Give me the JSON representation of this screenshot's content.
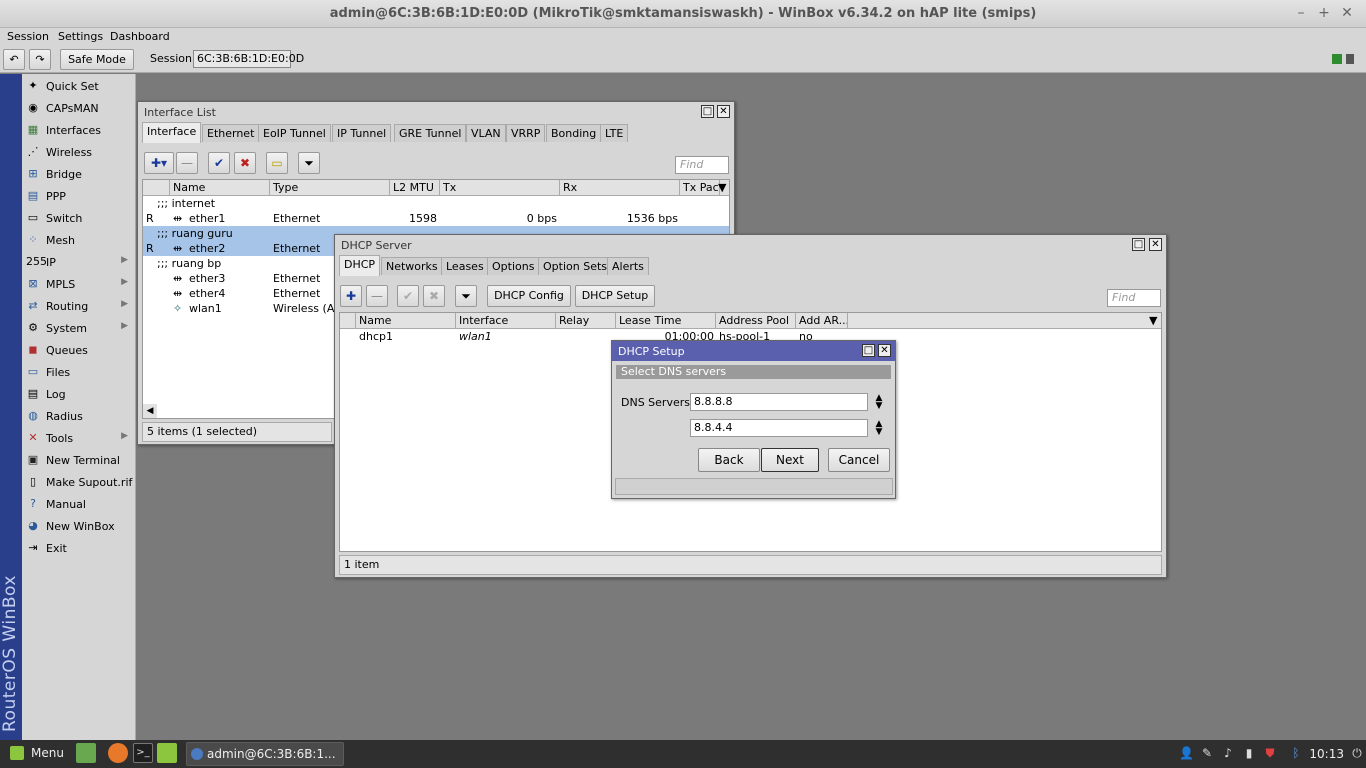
{
  "window": {
    "title": "admin@6C:3B:6B:1D:E0:0D (MikroTik@smktamansiswaskh) - WinBox v6.34.2 on hAP lite (smips)",
    "minimize": "–",
    "maximize": "+",
    "close": "✕"
  },
  "menubar": {
    "session": "Session",
    "settings": "Settings",
    "dashboard": "Dashboard"
  },
  "toolbar": {
    "undo": "↶",
    "redo": "↷",
    "safe_mode": "Safe Mode",
    "session_label": "Session:",
    "session_value": "6C:3B:6B:1D:E0:0D"
  },
  "brand": "RouterOS WinBox",
  "sidebar": [
    {
      "label": "Quick Set",
      "icon": "quick-set-icon"
    },
    {
      "label": "CAPsMAN",
      "icon": "capsman-icon"
    },
    {
      "label": "Interfaces",
      "icon": "interfaces-icon"
    },
    {
      "label": "Wireless",
      "icon": "wireless-icon"
    },
    {
      "label": "Bridge",
      "icon": "bridge-icon"
    },
    {
      "label": "PPP",
      "icon": "ppp-icon"
    },
    {
      "label": "Switch",
      "icon": "switch-icon"
    },
    {
      "label": "Mesh",
      "icon": "mesh-icon"
    },
    {
      "label": "IP",
      "icon": "ip-icon",
      "arrow": "▶"
    },
    {
      "label": "MPLS",
      "icon": "mpls-icon",
      "arrow": "▶"
    },
    {
      "label": "Routing",
      "icon": "routing-icon",
      "arrow": "▶"
    },
    {
      "label": "System",
      "icon": "system-icon",
      "arrow": "▶"
    },
    {
      "label": "Queues",
      "icon": "queues-icon"
    },
    {
      "label": "Files",
      "icon": "files-icon"
    },
    {
      "label": "Log",
      "icon": "log-icon"
    },
    {
      "label": "Radius",
      "icon": "radius-icon"
    },
    {
      "label": "Tools",
      "icon": "tools-icon",
      "arrow": "▶"
    },
    {
      "label": "New Terminal",
      "icon": "terminal-icon"
    },
    {
      "label": "Make Supout.rif",
      "icon": "supout-icon"
    },
    {
      "label": "Manual",
      "icon": "manual-icon"
    },
    {
      "label": "New WinBox",
      "icon": "winbox-icon"
    },
    {
      "label": "Exit",
      "icon": "exit-icon"
    }
  ],
  "interface_list": {
    "title": "Interface List",
    "tabs": [
      "Interface",
      "Ethernet",
      "EoIP Tunnel",
      "IP Tunnel",
      "GRE Tunnel",
      "VLAN",
      "VRRP",
      "Bonding",
      "LTE"
    ],
    "find_placeholder": "Find",
    "columns": [
      "Name",
      "Type",
      "L2 MTU",
      "Tx",
      "Rx",
      "Tx Pac"
    ],
    "rows": [
      {
        "comment": ";;; internet"
      },
      {
        "flag": "R",
        "name": "ether1",
        "type": "Ethernet",
        "mtu": "1598",
        "tx": "0 bps",
        "rx": "1536 bps"
      },
      {
        "comment": ";;; ruang guru"
      },
      {
        "flag": "R",
        "name": "ether2",
        "type": "Ethernet",
        "mtu": "",
        "tx": "",
        "rx": ""
      },
      {
        "comment": ";;; ruang bp"
      },
      {
        "flag": "",
        "name": "ether3",
        "type": "Ethernet",
        "mtu": "",
        "tx": "",
        "rx": ""
      },
      {
        "flag": "",
        "name": "ether4",
        "type": "Ethernet",
        "mtu": "",
        "tx": "",
        "rx": ""
      },
      {
        "flag": "",
        "name": "wlan1",
        "type": "Wireless (At",
        "mtu": "",
        "tx": "",
        "rx": ""
      }
    ],
    "status": "5 items (1 selected)"
  },
  "dhcp_server": {
    "title": "DHCP Server",
    "tabs": [
      "DHCP",
      "Networks",
      "Leases",
      "Options",
      "Option Sets",
      "Alerts"
    ],
    "buttons": {
      "dhcp_config": "DHCP Config",
      "dhcp_setup": "DHCP Setup"
    },
    "find_placeholder": "Find",
    "columns": [
      "Name",
      "Interface",
      "Relay",
      "Lease Time",
      "Address Pool",
      "Add AR..."
    ],
    "rows": [
      {
        "name": "dhcp1",
        "interface": "wlan1",
        "relay": "",
        "lease": "01:00:00",
        "pool": "hs-pool-1",
        "arp": "no"
      }
    ],
    "status": "1 item"
  },
  "dhcp_setup": {
    "title": "DHCP Setup",
    "section": "Select DNS servers",
    "dns_label": "DNS Servers",
    "dns1": "8.8.8.8",
    "dns2": "8.8.4.4",
    "back": "Back",
    "next": "Next",
    "cancel": "Cancel"
  },
  "taskbar": {
    "menu": "Menu",
    "task": "admin@6C:3B:6B:1...",
    "clock": "10:13"
  }
}
